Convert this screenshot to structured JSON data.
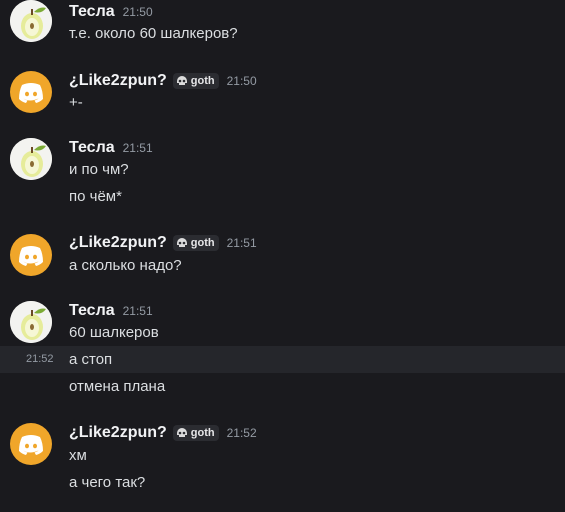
{
  "messages": [
    {
      "author": "Тесла",
      "avatar_icon": "pear-icon",
      "time": "21:50",
      "lines": [
        "т.е. около 60 шалкеров?"
      ]
    },
    {
      "author": "¿Like2zpun?",
      "avatar_icon": "discord-icon",
      "tag": "goth",
      "time": "21:50",
      "lines": [
        "+-"
      ]
    },
    {
      "author": "Тесла",
      "avatar_icon": "pear-icon",
      "time": "21:51",
      "lines": [
        "и по чм?",
        "по чём*"
      ]
    },
    {
      "author": "¿Like2zpun?",
      "avatar_icon": "discord-icon",
      "tag": "goth",
      "time": "21:51",
      "lines": [
        "а сколько надо?"
      ]
    },
    {
      "author": "Тесла",
      "avatar_icon": "pear-icon",
      "time": "21:51",
      "lines": [
        "60 шалкеров",
        "а стоп",
        "отмена плана"
      ],
      "hover_time": "21:52"
    },
    {
      "author": "¿Like2zpun?",
      "avatar_icon": "discord-icon",
      "tag": "goth",
      "time": "21:52",
      "lines": [
        "хм",
        "а чего так?"
      ]
    }
  ],
  "colors": {
    "background": "#1a1a1e",
    "discord_avatar": "#f0a62a",
    "hover_row": "#25262b"
  }
}
